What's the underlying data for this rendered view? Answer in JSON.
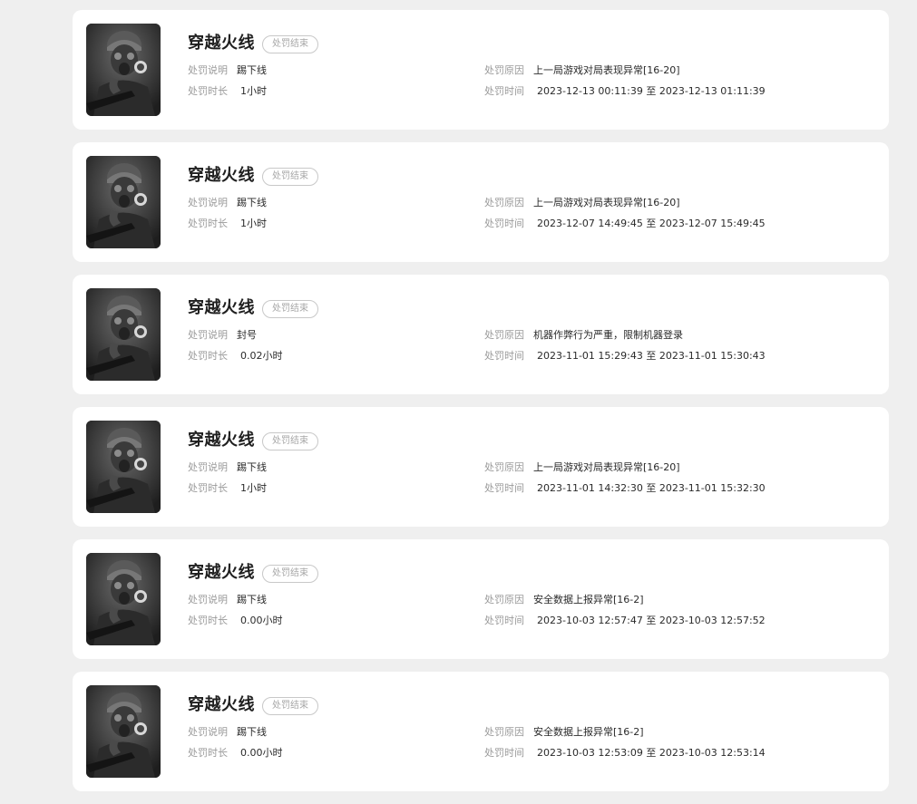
{
  "labels": {
    "desc": "处罚说明",
    "duration": "处罚时长",
    "reason": "处罚原因",
    "time": "处罚时间",
    "to": "至"
  },
  "colors": {
    "background": "#efefef",
    "card": "#ffffff",
    "title": "#1f1f1f",
    "label": "#9a9a9a",
    "badge_border": "#c8c8c8"
  },
  "records": [
    {
      "game": "穿越火线",
      "status": "处罚结束",
      "desc": "踢下线",
      "duration": "1小时",
      "reason": "上一局游戏对局表现异常[16-20]",
      "start": "2023-12-13 00:11:39",
      "end": "2023-12-13 01:11:39",
      "avatar_icon": "soldier-gas-mask-icon"
    },
    {
      "game": "穿越火线",
      "status": "处罚结束",
      "desc": "踢下线",
      "duration": "1小时",
      "reason": "上一局游戏对局表现异常[16-20]",
      "start": "2023-12-07 14:49:45",
      "end": "2023-12-07 15:49:45",
      "avatar_icon": "soldier-gas-mask-icon"
    },
    {
      "game": "穿越火线",
      "status": "处罚结束",
      "desc": "封号",
      "duration": "0.02小时",
      "reason": "机器作弊行为严重，限制机器登录",
      "start": "2023-11-01 15:29:43",
      "end": "2023-11-01 15:30:43",
      "avatar_icon": "soldier-gas-mask-icon"
    },
    {
      "game": "穿越火线",
      "status": "处罚结束",
      "desc": "踢下线",
      "duration": "1小时",
      "reason": "上一局游戏对局表现异常[16-20]",
      "start": "2023-11-01 14:32:30",
      "end": "2023-11-01 15:32:30",
      "avatar_icon": "soldier-gas-mask-icon"
    },
    {
      "game": "穿越火线",
      "status": "处罚结束",
      "desc": "踢下线",
      "duration": "0.00小时",
      "reason": "安全数据上报异常[16-2]",
      "start": "2023-10-03 12:57:47",
      "end": "2023-10-03 12:57:52",
      "avatar_icon": "soldier-gas-mask-icon"
    },
    {
      "game": "穿越火线",
      "status": "处罚结束",
      "desc": "踢下线",
      "duration": "0.00小时",
      "reason": "安全数据上报异常[16-2]",
      "start": "2023-10-03 12:53:09",
      "end": "2023-10-03 12:53:14",
      "avatar_icon": "soldier-gas-mask-icon"
    }
  ]
}
